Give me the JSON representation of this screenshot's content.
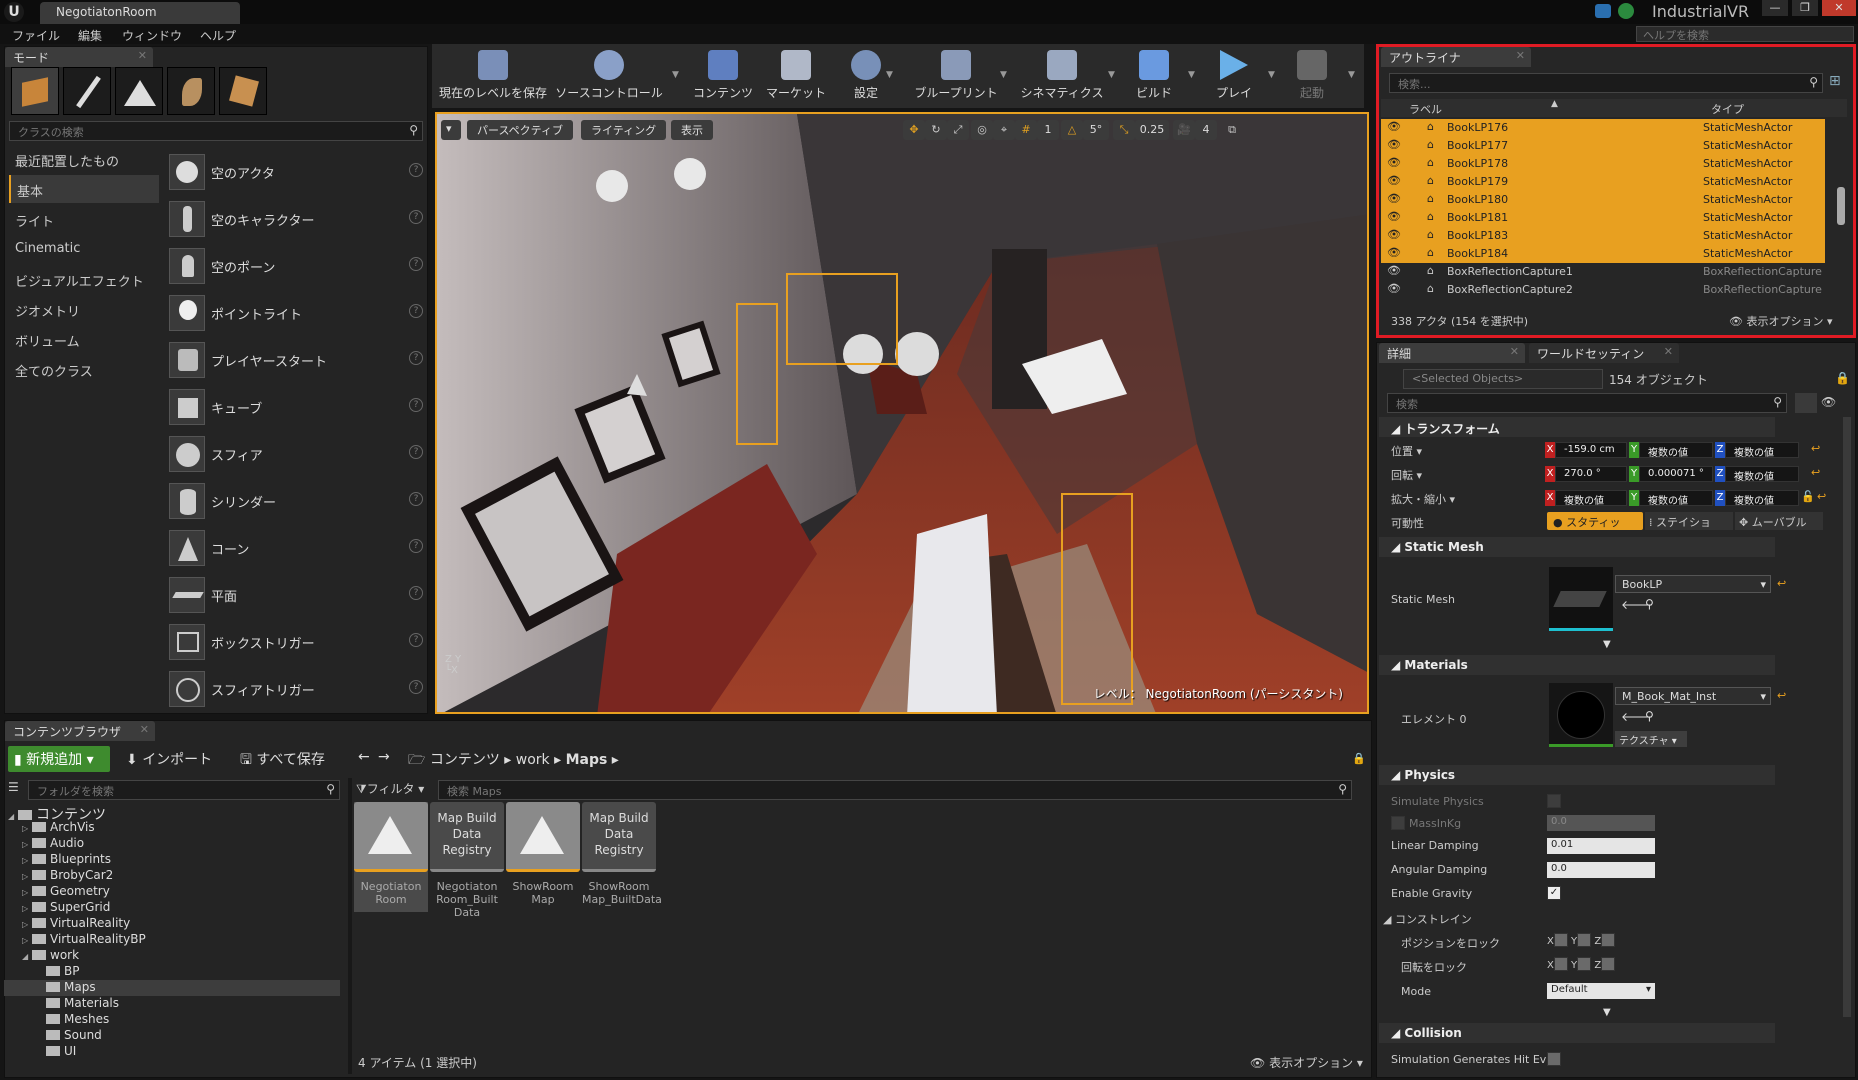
{
  "window": {
    "doc_tab": "NegotiatonRoom",
    "project_name": "IndustrialVR",
    "logo": "U",
    "min": "—",
    "max": "❐",
    "close": "✕"
  },
  "menu": [
    "ファイル",
    "編集",
    "ウィンドウ",
    "ヘルプ"
  ],
  "help_search_placeholder": "ヘルプを検索",
  "modes": {
    "tab_label": "モード",
    "search_placeholder": "クラスの検索",
    "mode_icons": [
      "place-mode-icon",
      "paint-mode-icon",
      "landscape-mode-icon",
      "foliage-mode-icon",
      "geometry-mode-icon"
    ],
    "categories": [
      "最近配置したもの",
      "基本",
      "ライト",
      "Cinematic",
      "ビジュアルエフェクト",
      "ジオメトリ",
      "ボリューム",
      "全てのクラス"
    ],
    "selected_category": "基本",
    "actors": [
      "空のアクタ",
      "空のキャラクター",
      "空のポーン",
      "ポイントライト",
      "プレイヤースタート",
      "キューブ",
      "スフィア",
      "シリンダー",
      "コーン",
      "平面",
      "ボックストリガー",
      "スフィアトリガー"
    ],
    "help_glyph": "?"
  },
  "toolbar": {
    "buttons": [
      "現在のレベルを保存",
      "ソースコントロール",
      "コンテンツ",
      "マーケット",
      "設定",
      "ブループリント",
      "シネマティクス",
      "ビルド",
      "プレイ",
      "起動"
    ]
  },
  "viewport": {
    "perspective": "パースペクティブ",
    "lighting": "ライティング",
    "show": "表示",
    "grid_snap": "1",
    "rot_snap": "5°",
    "scale_snap": "0.25",
    "cam_speed": "4",
    "level_label": "レベル：",
    "level_name": "NegotiatonRoom (パーシスタント)"
  },
  "outliner": {
    "tab_label": "アウトライナ",
    "search_placeholder": "検索...",
    "col_label": "ラベル",
    "col_type": "タイプ",
    "rows": [
      {
        "label": "BookLP176",
        "type": "StaticMeshActor",
        "selected": true
      },
      {
        "label": "BookLP177",
        "type": "StaticMeshActor",
        "selected": true
      },
      {
        "label": "BookLP178",
        "type": "StaticMeshActor",
        "selected": true
      },
      {
        "label": "BookLP179",
        "type": "StaticMeshActor",
        "selected": true
      },
      {
        "label": "BookLP180",
        "type": "StaticMeshActor",
        "selected": true
      },
      {
        "label": "BookLP181",
        "type": "StaticMeshActor",
        "selected": true
      },
      {
        "label": "BookLP183",
        "type": "StaticMeshActor",
        "selected": true
      },
      {
        "label": "BookLP184",
        "type": "StaticMeshActor",
        "selected": true
      },
      {
        "label": "BoxReflectionCapture1",
        "type": "BoxReflectionCapture",
        "selected": false
      },
      {
        "label": "BoxReflectionCapture2",
        "type": "BoxReflectionCapture",
        "selected": false
      }
    ],
    "status": "338 アクタ (154 を選択中)",
    "view_options": "表示オプション"
  },
  "details": {
    "tab_label": "詳細",
    "world_tab_label": "ワールドセッティン",
    "selected_objects": "<Selected Objects>",
    "object_count": "154 オブジェクト",
    "search_placeholder": "検索",
    "transform": {
      "header": "トランスフォーム",
      "location_label": "位置",
      "rotation_label": "回転",
      "scale_label": "拡大・縮小",
      "mobility_label": "可動性",
      "location": [
        "-159.0 cm",
        "複数の値",
        "複数の値"
      ],
      "rotation": [
        "270.0 °",
        "0.000071 °",
        "複数の値"
      ],
      "scale": [
        "複数の値",
        "複数の値",
        "複数の値"
      ],
      "mobility": [
        "スタティッ",
        "ステイショ",
        "ムーバブル"
      ],
      "axis_x": "X",
      "axis_y": "Y",
      "axis_z": "Z"
    },
    "static_mesh": {
      "header": "Static Mesh",
      "label": "Static Mesh",
      "value": "BookLP"
    },
    "materials": {
      "header": "Materials",
      "element_label": "エレメント 0",
      "value": "M_Book_Mat_Inst",
      "texture_button": "テクスチャ"
    },
    "physics": {
      "header": "Physics",
      "simulate_label": "Simulate Physics",
      "mass_label": "MassInKg",
      "mass_value": "0.0",
      "linear_label": "Linear Damping",
      "linear_value": "0.01",
      "angular_label": "Angular Damping",
      "angular_value": "0.0",
      "gravity_label": "Enable Gravity",
      "constraints_label": "コンストレイン",
      "lock_pos_label": "ポジションをロック",
      "lock_rot_label": "回転をロック",
      "mode_label": "Mode",
      "mode_value": "Default"
    },
    "collision": {
      "header": "Collision",
      "hit_events_label": "Simulation Generates Hit Ev"
    }
  },
  "content_browser": {
    "tab_label": "コンテンツブラウザ",
    "add_new": "新規追加",
    "import": "インポート",
    "save_all": "すべて保存",
    "breadcrumb": [
      "コンテンツ",
      "work",
      "Maps"
    ],
    "folder_search_placeholder": "フォルダを検索",
    "filter_label": "フィルタ",
    "asset_search_placeholder": "検索 Maps",
    "tree": [
      {
        "name": "コンテンツ",
        "level": 0,
        "expanded": true
      },
      {
        "name": "ArchVis",
        "level": 1
      },
      {
        "name": "Audio",
        "level": 1
      },
      {
        "name": "Blueprints",
        "level": 1
      },
      {
        "name": "BrobyCar2",
        "level": 1
      },
      {
        "name": "Geometry",
        "level": 1
      },
      {
        "name": "SuperGrid",
        "level": 1
      },
      {
        "name": "VirtualReality",
        "level": 1
      },
      {
        "name": "VirtualRealityBP",
        "level": 1
      },
      {
        "name": "work",
        "level": 1,
        "expanded": true
      },
      {
        "name": "BP",
        "level": 2
      },
      {
        "name": "Maps",
        "level": 2,
        "selected": true
      },
      {
        "name": "Materials",
        "level": 2
      },
      {
        "name": "Meshes",
        "level": 2
      },
      {
        "name": "Sound",
        "level": 2
      },
      {
        "name": "UI",
        "level": 2
      }
    ],
    "assets": [
      {
        "thumb": "",
        "name": "Negotiaton Room",
        "kind": "map"
      },
      {
        "thumb": "Map Build Data Registry",
        "name": "Negotiaton Room_Built Data",
        "kind": "data"
      },
      {
        "thumb": "",
        "name": "ShowRoom Map",
        "kind": "map"
      },
      {
        "thumb": "Map Build Data Registry",
        "name": "ShowRoom Map_BuiltData",
        "kind": "data"
      }
    ],
    "item_count": "4 アイテム (1 選択中)",
    "view_options": "表示オプション"
  },
  "colors": {
    "selection": "#e8a020",
    "highlight_border": "#e01b24",
    "add_button": "#3e8b2e"
  }
}
